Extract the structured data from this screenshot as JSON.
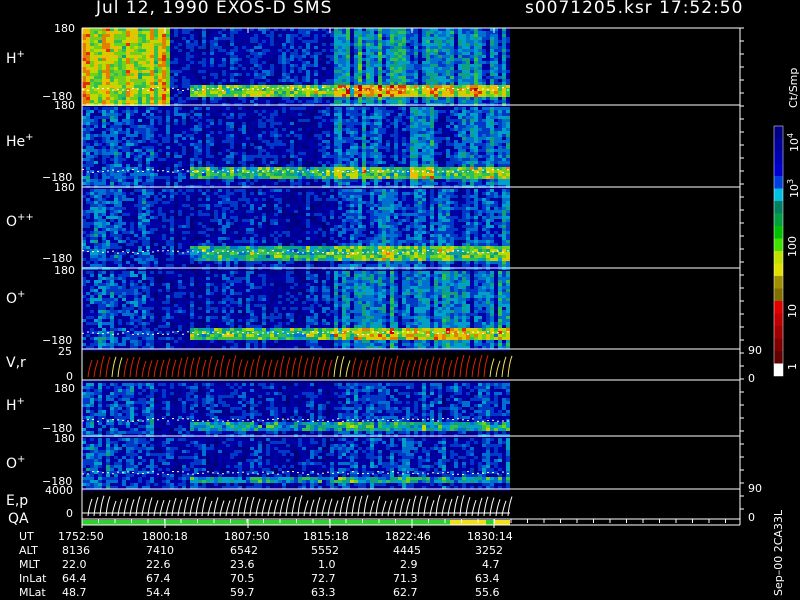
{
  "header": {
    "title": "Jul 12, 1990   EXOS-D SMS",
    "file": "s0071205.ksr  17:52:50"
  },
  "colorbar": {
    "unit_label": "Ct/Smp",
    "tick_labels": [
      "1",
      "10",
      "100",
      "10",
      "10"
    ],
    "tick_exponents": [
      "",
      "",
      "",
      "3",
      "4"
    ],
    "colors": [
      "#000080",
      "#00009a",
      "#0000b4",
      "#0000d0",
      "#0040e0",
      "#00c0e0",
      "#008060",
      "#00a040",
      "#00c000",
      "#40e000",
      "#c0e000",
      "#e0e000",
      "#a09000",
      "#807000",
      "#e00000",
      "#c00000",
      "#a00000",
      "#800000",
      "#600000",
      "#ffffff"
    ]
  },
  "panels": [
    {
      "label": "H",
      "sup": "+",
      "top_tick": "180",
      "bottom_tick": "−180"
    },
    {
      "label": "He",
      "sup": "+",
      "top_tick": "180",
      "bottom_tick": "−180"
    },
    {
      "label": "O",
      "sup": "++",
      "top_tick": "180",
      "bottom_tick": "−180"
    },
    {
      "label": "O",
      "sup": "+",
      "top_tick": "180",
      "bottom_tick": "−180"
    },
    {
      "label": "V,r",
      "sup": "",
      "top_tick": "25",
      "bottom_tick": "0",
      "right_top": "90",
      "right_bottom": "0"
    },
    {
      "label": "H",
      "sup": "+",
      "top_tick": "180",
      "bottom_tick": "−180"
    },
    {
      "label": "O",
      "sup": "+",
      "top_tick": "180",
      "bottom_tick": "−180"
    },
    {
      "label": "E,p",
      "sup": "",
      "top_tick": "4000",
      "bottom_tick": "0",
      "right_top": "90",
      "right_bottom": "0"
    }
  ],
  "qa_label": "QA",
  "footer": {
    "side_text": "Sep–00  2CA33L",
    "rows": [
      {
        "name": "UT",
        "values": [
          "1752:50",
          "1800:18",
          "1807:50",
          "1815:18",
          "1822:46",
          "1830:14"
        ]
      },
      {
        "name": "ALT",
        "values": [
          "8136",
          "7410",
          "6542",
          "5552",
          "4445",
          "3252"
        ]
      },
      {
        "name": "MLT",
        "values": [
          "22.0",
          "22.6",
          "23.6",
          "1.0",
          "2.9",
          "4.7"
        ]
      },
      {
        "name": "InLat",
        "values": [
          "64.4",
          "67.4",
          "70.5",
          "72.7",
          "71.3",
          "63.4"
        ]
      },
      {
        "name": "MLat",
        "values": [
          "48.7",
          "54.4",
          "59.7",
          "63.3",
          "62.7",
          "55.6"
        ]
      }
    ]
  },
  "chart_data": {
    "type": "heatmap",
    "title": "Jul 12, 1990   EXOS-D SMS",
    "x": [
      "1752:50",
      "1800:18",
      "1807:50",
      "1815:18",
      "1822:46",
      "1830:14"
    ],
    "xlabel": "UT",
    "ylim": [
      -180,
      180
    ],
    "colorscale": "log",
    "colorbar_range": [
      1,
      10000
    ],
    "colorbar_label": "Ct/Smp",
    "series": [
      {
        "name": "H+",
        "ylim": [
          -180,
          180
        ]
      },
      {
        "name": "He+",
        "ylim": [
          -180,
          180
        ]
      },
      {
        "name": "O++",
        "ylim": [
          -180,
          180
        ]
      },
      {
        "name": "O+",
        "ylim": [
          -180,
          180
        ]
      },
      {
        "name": "V,r",
        "ylim": [
          0,
          25
        ],
        "right_ylim": [
          0,
          90
        ]
      },
      {
        "name": "H+",
        "ylim": [
          -180,
          180
        ]
      },
      {
        "name": "O+",
        "ylim": [
          -180,
          180
        ]
      },
      {
        "name": "E,p",
        "ylim": [
          0,
          4000
        ],
        "right_ylim": [
          0,
          90
        ]
      }
    ]
  }
}
